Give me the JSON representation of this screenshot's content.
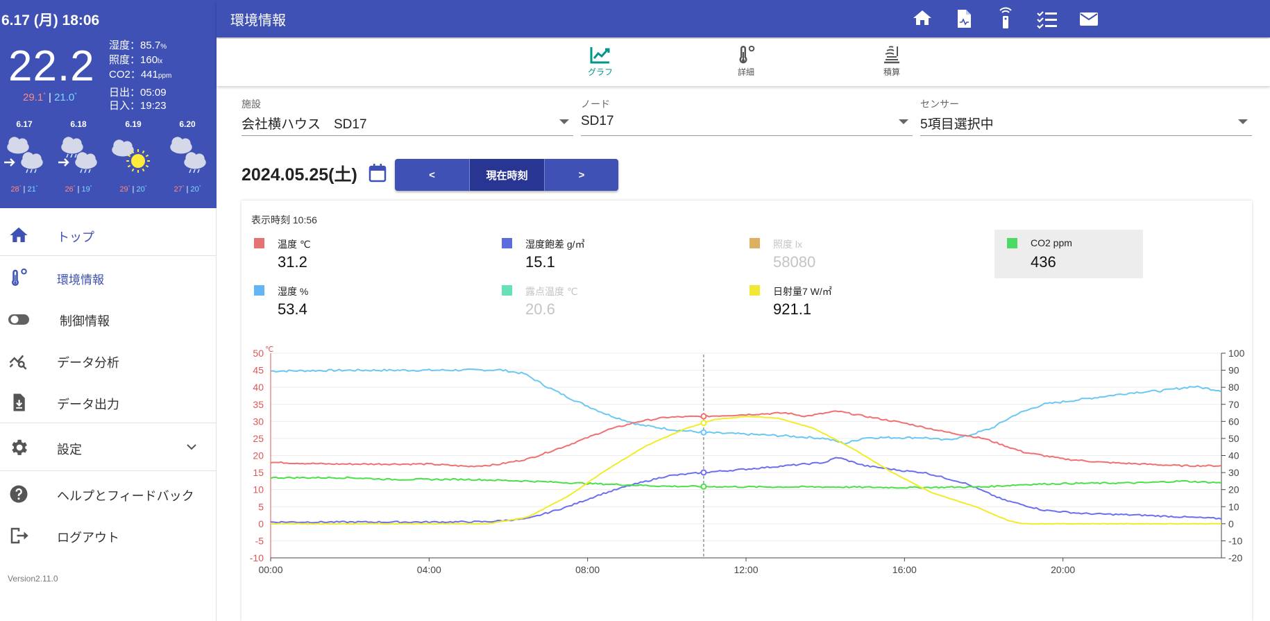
{
  "sidebar": {
    "weather": {
      "datetime": "6.17 (月) 18:06",
      "current_temp": "22.2",
      "temp_high": "29.1",
      "temp_low": "21.0",
      "humidity_label": "湿度：",
      "humidity_value": "85.7",
      "humidity_unit": "%",
      "illuminance_label": "照度：",
      "illuminance_value": "160",
      "illuminance_unit": "lx",
      "co2_label": "CO2：",
      "co2_value": "441",
      "co2_unit": "ppm",
      "sunrise": "日出：05:09",
      "sunset": "日入：19:23",
      "forecast": [
        {
          "date": "6.17",
          "icon": "cloud-to-rain-icon",
          "high": "28",
          "low": "21"
        },
        {
          "date": "6.18",
          "icon": "rain-to-cloud-icon",
          "high": "26",
          "low": "19"
        },
        {
          "date": "6.19",
          "icon": "cloud-sun-icon",
          "high": "29",
          "low": "20"
        },
        {
          "date": "6.20",
          "icon": "cloud-rain-icon",
          "high": "27",
          "low": "20"
        }
      ]
    },
    "nav": [
      {
        "label": "トップ",
        "icon": "home-icon"
      },
      {
        "label": "環境情報",
        "icon": "thermometer-icon",
        "active": true
      },
      {
        "label": "制御情報",
        "icon": "toggle-icon"
      },
      {
        "label": "データ分析",
        "icon": "analytics-icon"
      },
      {
        "label": "データ出力",
        "icon": "download-file-icon"
      },
      {
        "label": "設定",
        "icon": "gear-icon"
      },
      {
        "label": "ヘルプとフィードバック",
        "icon": "help-icon"
      },
      {
        "label": "ログアウト",
        "icon": "logout-icon"
      }
    ],
    "version": "Version2.11.0"
  },
  "header": {
    "title": "環境情報",
    "icons": [
      "home-icon",
      "report-icon",
      "remote-icon",
      "checklist-icon",
      "mail-icon"
    ]
  },
  "tabs": [
    {
      "label": "グラフ",
      "icon": "chart-icon",
      "active": true
    },
    {
      "label": "詳細",
      "icon": "thermometer-icon"
    },
    {
      "label": "積算",
      "icon": "integration-icon"
    }
  ],
  "filters": {
    "facility": {
      "label": "施設",
      "value": "会社横ハウス　SD17"
    },
    "node": {
      "label": "ノード",
      "value": "SD17"
    },
    "sensor": {
      "label": "センサー",
      "value": "5項目選択中"
    }
  },
  "date_nav": {
    "date": "2024.05.25(土)",
    "prev": "<",
    "now": "現在時刻",
    "next": ">"
  },
  "chart_panel": {
    "display_time": "表示時刻 10:56",
    "legend": [
      {
        "name": "温度 ℃",
        "value": "31.2",
        "color": "#e57373",
        "active": true
      },
      {
        "name": "湿度飽差 g/㎥",
        "value": "15.1",
        "color": "#5c6bde",
        "active": true
      },
      {
        "name": "照度 lx",
        "value": "58080",
        "color": "#dcb060",
        "active": false
      },
      {
        "name": "CO2 ppm",
        "value": "436",
        "color": "#4cd964",
        "active": true,
        "highlighted": true
      },
      {
        "name": "湿度 %",
        "value": "53.4",
        "color": "#64b5f6",
        "active": true
      },
      {
        "name": "露点温度 ℃",
        "value": "20.6",
        "color": "#66e0b8",
        "active": false
      },
      {
        "name": "日射量7 W/㎡",
        "value": "921.1",
        "color": "#f0e832",
        "active": true
      }
    ]
  },
  "chart_data": {
    "type": "line",
    "left_axis_unit": "℃",
    "left_axis": {
      "min": -10,
      "max": 50,
      "ticks": [
        50,
        45,
        40,
        35,
        30,
        25,
        20,
        15,
        10,
        5,
        0,
        -5,
        -10
      ]
    },
    "right_axis": {
      "min": -20,
      "max": 100,
      "ticks": [
        100,
        90,
        80,
        70,
        60,
        50,
        40,
        30,
        20,
        10,
        0,
        -10,
        -20
      ]
    },
    "x_ticks": [
      "00:00",
      "04:00",
      "08:00",
      "12:00",
      "16:00",
      "20:00"
    ],
    "x_range_hours": [
      0,
      24
    ],
    "cursor_hour": 10.93,
    "series": [
      {
        "name": "湿度 %",
        "axis": "right",
        "color": "#6ac8f2",
        "points": [
          [
            0,
            89.5
          ],
          [
            2,
            90
          ],
          [
            4,
            90
          ],
          [
            5.8,
            90.2
          ],
          [
            6.4,
            88
          ],
          [
            7,
            80
          ],
          [
            7.7,
            72
          ],
          [
            8.5,
            64
          ],
          [
            9.3,
            58
          ],
          [
            10.2,
            55
          ],
          [
            11,
            53.4
          ],
          [
            12,
            52.5
          ],
          [
            13,
            51.5
          ],
          [
            14,
            50
          ],
          [
            14.5,
            47
          ],
          [
            15,
            50.5
          ],
          [
            16.5,
            50.5
          ],
          [
            17,
            49
          ],
          [
            17.5,
            51
          ],
          [
            18.2,
            56
          ],
          [
            18.8,
            64
          ],
          [
            19.5,
            70
          ],
          [
            20.5,
            73
          ],
          [
            21.8,
            77
          ],
          [
            22.5,
            78
          ],
          [
            23.3,
            80.5
          ],
          [
            24,
            78
          ]
        ]
      },
      {
        "name": "温度 ℃",
        "axis": "left",
        "color": "#f07070",
        "points": [
          [
            0,
            18
          ],
          [
            1.5,
            17.5
          ],
          [
            3,
            17.5
          ],
          [
            4,
            17.5
          ],
          [
            5,
            16.8
          ],
          [
            5.7,
            17.3
          ],
          [
            6.5,
            19
          ],
          [
            7.5,
            23
          ],
          [
            8.5,
            27.5
          ],
          [
            9.3,
            30
          ],
          [
            10,
            31.2
          ],
          [
            11,
            31.5
          ],
          [
            12,
            32
          ],
          [
            13,
            32.5
          ],
          [
            13.5,
            31.5
          ],
          [
            14.3,
            33
          ],
          [
            15,
            31.5
          ],
          [
            16,
            29.5
          ],
          [
            17,
            27
          ],
          [
            18,
            25
          ],
          [
            19,
            21
          ],
          [
            20,
            19
          ],
          [
            21,
            18
          ],
          [
            22,
            17.5
          ],
          [
            23,
            17
          ],
          [
            24,
            17
          ]
        ]
      },
      {
        "name": "湿度飽差 g/㎥",
        "axis": "left",
        "color": "#6a6ff0",
        "points": [
          [
            0,
            0.5
          ],
          [
            2,
            0.5
          ],
          [
            4,
            0.5
          ],
          [
            5.5,
            0.6
          ],
          [
            6.5,
            1.5
          ],
          [
            7.5,
            5
          ],
          [
            8.3,
            8.5
          ],
          [
            9,
            11
          ],
          [
            10,
            14
          ],
          [
            11,
            15.1
          ],
          [
            12,
            16
          ],
          [
            13,
            17
          ],
          [
            14,
            18
          ],
          [
            14.3,
            19.5
          ],
          [
            15,
            17
          ],
          [
            16,
            15.5
          ],
          [
            16.5,
            15
          ],
          [
            17.5,
            12
          ],
          [
            18.5,
            7
          ],
          [
            19.5,
            4
          ],
          [
            20.5,
            3
          ],
          [
            22,
            2.5
          ],
          [
            24,
            1.5
          ]
        ]
      },
      {
        "name": "CO2 ppm",
        "axis": "left",
        "color": "#4ae048",
        "points": [
          [
            0,
            13.5
          ],
          [
            2,
            13.5
          ],
          [
            3,
            13
          ],
          [
            5,
            13
          ],
          [
            6.5,
            12.5
          ],
          [
            8,
            11.8
          ],
          [
            10,
            11
          ],
          [
            12,
            10.8
          ],
          [
            14,
            10.8
          ],
          [
            16,
            10.6
          ],
          [
            18,
            10.8
          ],
          [
            19,
            11.5
          ],
          [
            20,
            11.8
          ],
          [
            22,
            12
          ],
          [
            23,
            12.5
          ],
          [
            24,
            12
          ]
        ]
      },
      {
        "name": "日射量7 W/㎡",
        "axis": "left",
        "color": "#f2ec28",
        "points": [
          [
            0,
            0
          ],
          [
            5.5,
            0
          ],
          [
            6.5,
            2
          ],
          [
            7.5,
            8
          ],
          [
            8.5,
            16
          ],
          [
            9.5,
            23
          ],
          [
            10.5,
            28
          ],
          [
            11.2,
            30.5
          ],
          [
            12,
            31.5
          ],
          [
            12.8,
            31
          ],
          [
            13.7,
            28
          ],
          [
            14.7,
            22
          ],
          [
            15.7,
            15
          ],
          [
            16.7,
            9
          ],
          [
            17.8,
            5
          ],
          [
            18.6,
            1
          ],
          [
            19,
            0
          ],
          [
            24,
            0
          ]
        ]
      }
    ]
  },
  "colors": {
    "primary": "#3f51b5",
    "primary_dark": "#283593",
    "tab_active": "#009688",
    "left_axis": "#e05555"
  }
}
